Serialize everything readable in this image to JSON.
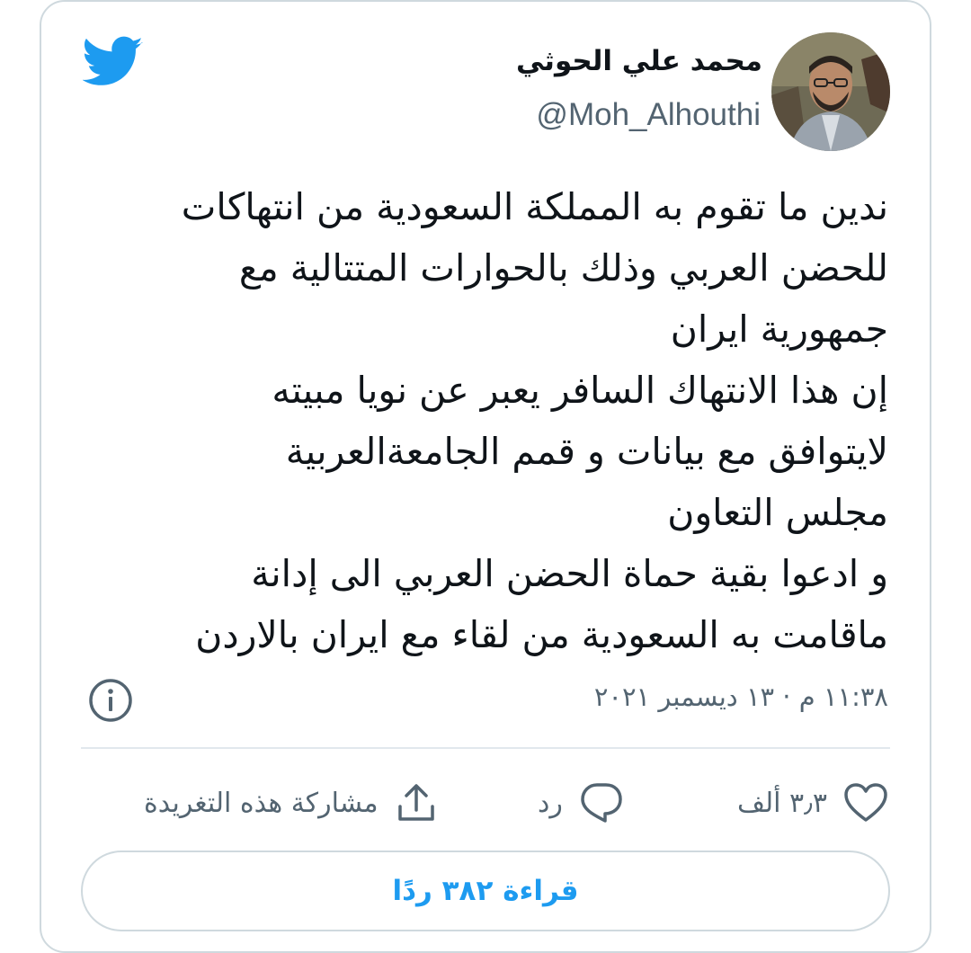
{
  "tweet": {
    "author": {
      "display_name": "محمد علي الحوثي",
      "handle": "@Moh_Alhouthi"
    },
    "body_lines": [
      "ندين ما تقوم به المملكة السعودية من انتهاكات",
      "للحضن العربي وذلك بالحوارات المتتالية مع",
      "جمهورية ايران",
      "إن هذا الانتهاك السافر يعبر عن نويا مبيته",
      "لايتوافق مع بيانات و قمم الجامعةالعربية",
      "مجلس التعاون",
      "و ادعوا بقية حماة الحضن العربي الى إدانة",
      "ماقامت به السعودية من لقاء مع ايران بالاردن"
    ],
    "timestamp": "١١:٣٨ م · ١٣ ديسمبر ٢٠٢١"
  },
  "actions": {
    "like_count": "٣٫٣ ألف",
    "reply_label": "رد",
    "share_label": "مشاركة هذه التغريدة"
  },
  "read_replies_label": "قراءة ٣٨٢ ردًا",
  "icons": {
    "brand": "twitter-bird-icon",
    "info": "info-icon",
    "like": "heart-icon",
    "reply": "speech-bubble-icon",
    "share": "share-upload-icon"
  },
  "colors": {
    "brand_blue": "#1d9bf0",
    "secondary_text": "#536471",
    "border": "#cfd9de"
  }
}
